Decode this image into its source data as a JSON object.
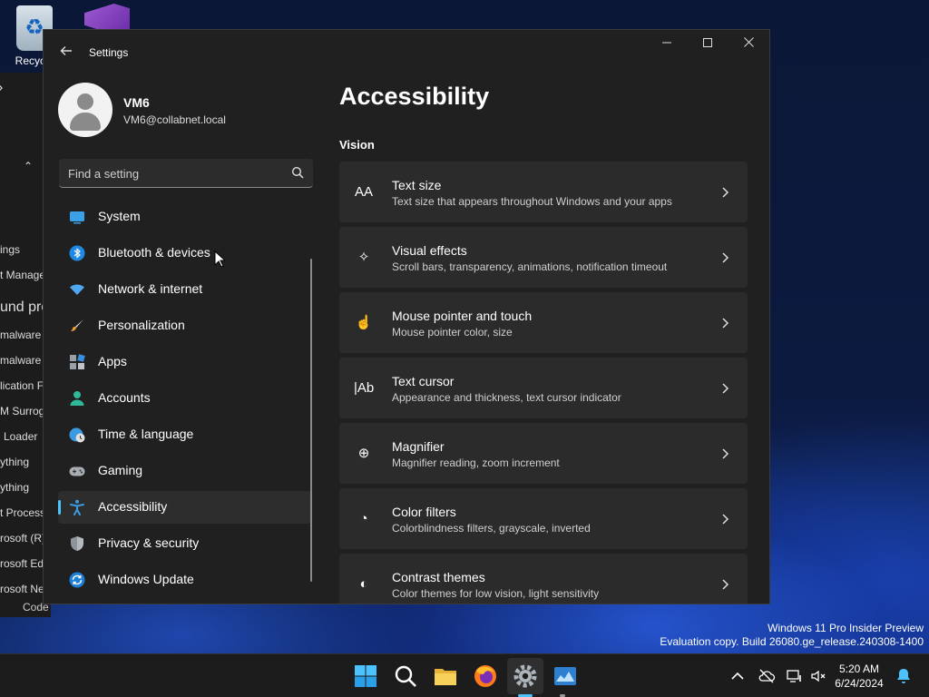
{
  "desktop": {
    "icons": [
      {
        "label": "Recycle"
      }
    ],
    "bg_window_fragments": [
      "ings",
      "t Manage",
      "und pro",
      "malware",
      "malware",
      "lication Fr",
      "M Surroga",
      "Loader",
      "ything",
      "ything",
      "t Process",
      "rosoft (R)",
      "rosoft Edi",
      "rosoft Ne"
    ],
    "bg_code_label": "Code",
    "watermark": {
      "line1": "Windows 11 Pro Insider Preview",
      "line2": "Evaluation copy. Build 26080.ge_release.240308-1400"
    }
  },
  "settings": {
    "window_title": "Settings",
    "user": {
      "name": "VM6",
      "email": "VM6@collabnet.local"
    },
    "search": {
      "placeholder": "Find a setting"
    },
    "nav_items": [
      {
        "label": "System",
        "icon": "monitor-icon"
      },
      {
        "label": "Bluetooth & devices",
        "icon": "bluetooth-icon"
      },
      {
        "label": "Network & internet",
        "icon": "wifi-icon"
      },
      {
        "label": "Personalization",
        "icon": "brush-icon"
      },
      {
        "label": "Apps",
        "icon": "apps-icon"
      },
      {
        "label": "Accounts",
        "icon": "person-icon"
      },
      {
        "label": "Time & language",
        "icon": "globe-clock-icon"
      },
      {
        "label": "Gaming",
        "icon": "gamepad-icon"
      },
      {
        "label": "Accessibility",
        "icon": "accessibility-icon",
        "active": true
      },
      {
        "label": "Privacy & security",
        "icon": "shield-icon"
      },
      {
        "label": "Windows Update",
        "icon": "update-icon"
      }
    ],
    "page_title": "Accessibility",
    "section_title": "Vision",
    "cards": [
      {
        "title": "Text size",
        "desc": "Text size that appears throughout Windows and your apps",
        "icon": "text-size-icon",
        "glyph": "AA"
      },
      {
        "title": "Visual effects",
        "desc": "Scroll bars, transparency, animations, notification timeout",
        "icon": "sparkle-icon",
        "glyph": "✧"
      },
      {
        "title": "Mouse pointer and touch",
        "desc": "Mouse pointer color, size",
        "icon": "pointer-icon",
        "glyph": "☝"
      },
      {
        "title": "Text cursor",
        "desc": "Appearance and thickness, text cursor indicator",
        "icon": "text-cursor-icon",
        "glyph": "|Ab"
      },
      {
        "title": "Magnifier",
        "desc": "Magnifier reading, zoom increment",
        "icon": "magnifier-icon",
        "glyph": "⊕"
      },
      {
        "title": "Color filters",
        "desc": "Colorblindness filters, grayscale, inverted",
        "icon": "palette-icon",
        "glyph": "◔"
      },
      {
        "title": "Contrast themes",
        "desc": "Color themes for low vision, light sensitivity",
        "icon": "contrast-icon",
        "glyph": "◐"
      }
    ]
  },
  "taskbar": {
    "apps": [
      "start-icon",
      "search-icon",
      "file-explorer-icon",
      "firefox-icon",
      "settings-icon",
      "app-icon"
    ],
    "active_app": "settings-icon",
    "clock": {
      "time": "5:20 AM",
      "date": "6/24/2024"
    }
  },
  "colors": {
    "accent": "#4cc2ff",
    "window_bg": "#202020",
    "card_bg": "#2b2b2b"
  }
}
